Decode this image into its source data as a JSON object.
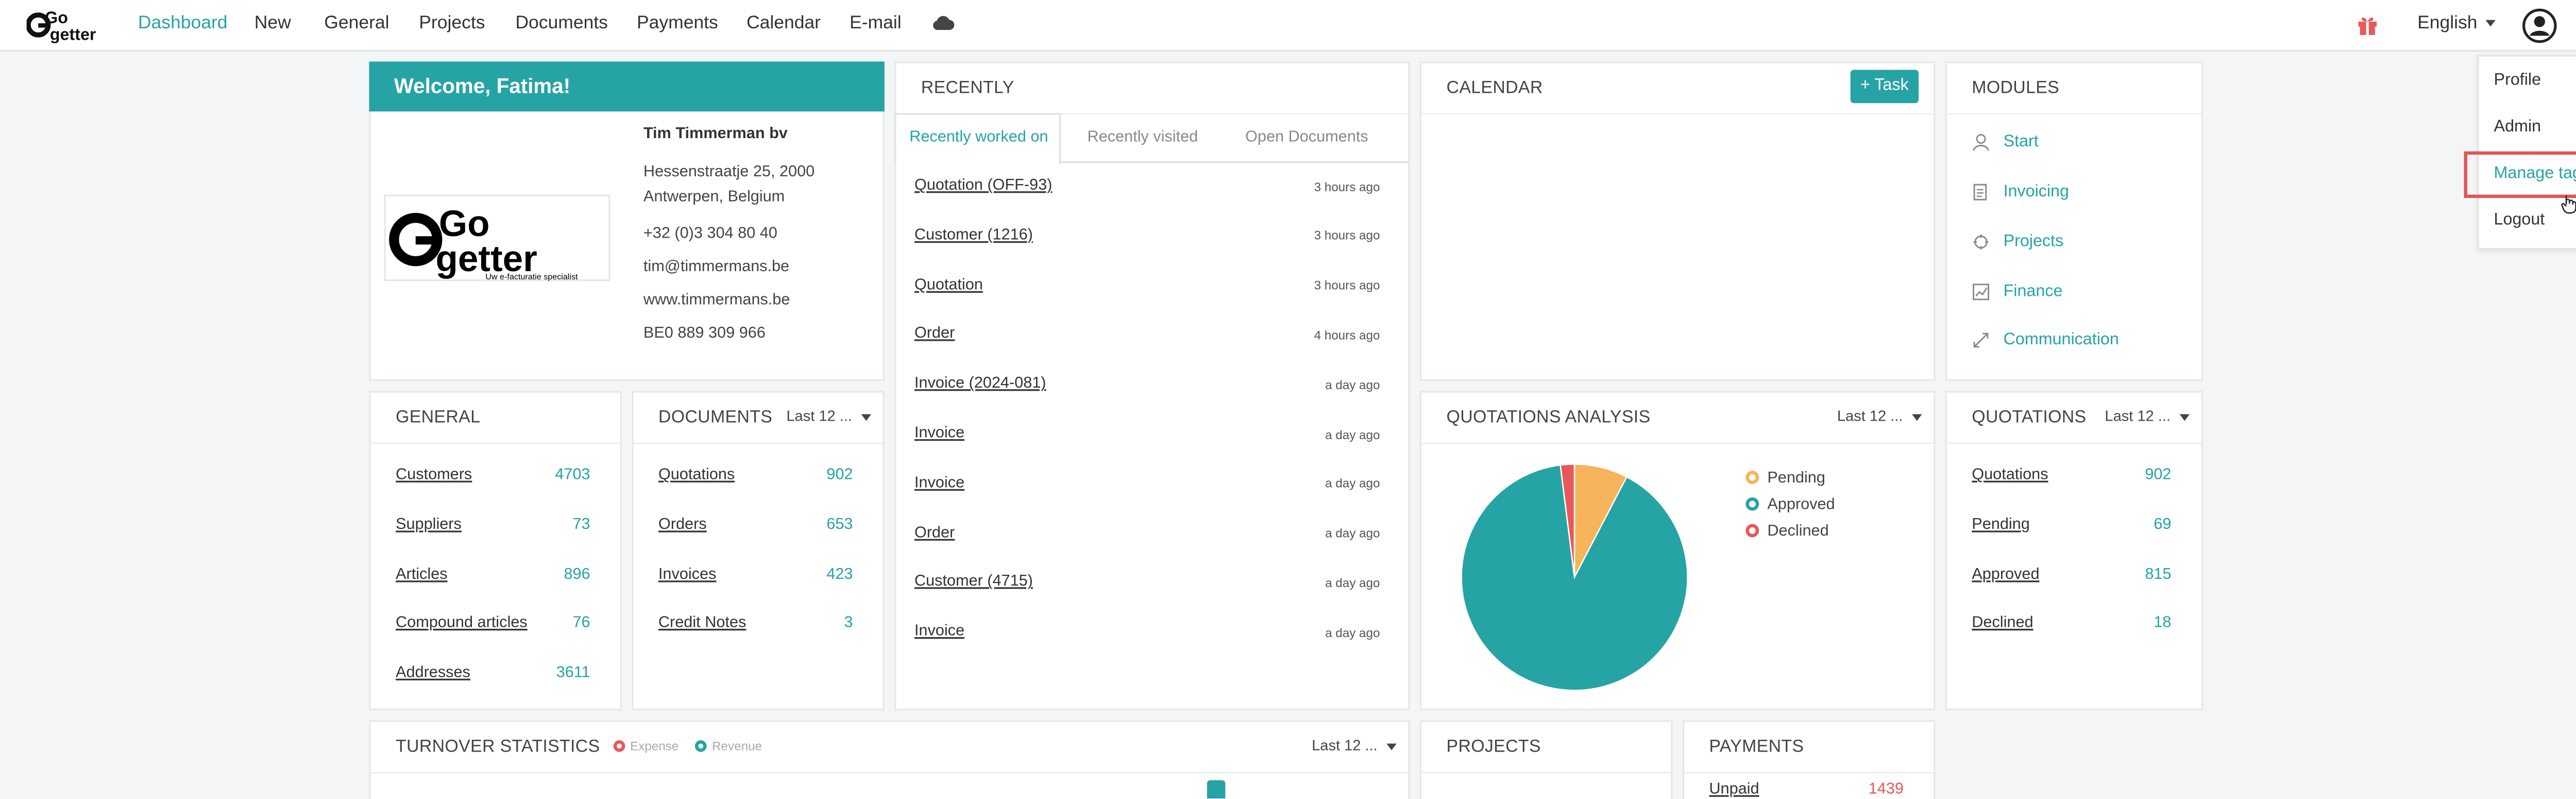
{
  "nav": {
    "items": [
      "Dashboard",
      "New",
      "General",
      "Projects",
      "Documents",
      "Payments",
      "Calendar",
      "E-mail"
    ],
    "language": "English"
  },
  "user_menu": {
    "items": [
      "Profile",
      "Admin",
      "Manage tags",
      "Logout"
    ],
    "highlighted": "Manage tags"
  },
  "welcome": {
    "title": "Welcome, Fatima!",
    "company": "Tim Timmerman bv",
    "address_line1": "Hessenstraatje 25, 2000",
    "address_line2": "Antwerpen, Belgium",
    "phone": "+32 (0)3 304 80 40",
    "email": "tim@timmermans.be",
    "website": "www.timmermans.be",
    "vat": "BE0 889 309 966",
    "logo_text": "Go getter",
    "logo_tagline": "Uw e-facturatie specialist"
  },
  "recently": {
    "title": "RECENTLY",
    "tabs": [
      "Recently worked on",
      "Recently visited",
      "Open Documents"
    ],
    "active_tab": "Recently worked on",
    "items": [
      {
        "label": "Quotation (OFF-93)",
        "time": "3 hours ago"
      },
      {
        "label": "Customer (1216)",
        "time": "3 hours ago"
      },
      {
        "label": "Quotation",
        "time": "3 hours ago"
      },
      {
        "label": "Order",
        "time": "4 hours ago"
      },
      {
        "label": "Invoice (2024-081)",
        "time": "a day ago"
      },
      {
        "label": "Invoice",
        "time": "a day ago"
      },
      {
        "label": "Invoice",
        "time": "a day ago"
      },
      {
        "label": "Order",
        "time": "a day ago"
      },
      {
        "label": "Customer (4715)",
        "time": "a day ago"
      },
      {
        "label": "Invoice",
        "time": "a day ago"
      }
    ]
  },
  "calendar": {
    "title": "CALENDAR",
    "task_button": "+ Task"
  },
  "modules": {
    "title": "MODULES",
    "items": [
      {
        "label": "Start",
        "icon": "person-icon"
      },
      {
        "label": "Invoicing",
        "icon": "invoice-icon"
      },
      {
        "label": "Projects",
        "icon": "projects-icon"
      },
      {
        "label": "Finance",
        "icon": "finance-icon"
      },
      {
        "label": "Communication",
        "icon": "communication-icon"
      }
    ]
  },
  "general": {
    "title": "GENERAL",
    "rows": [
      {
        "label": "Customers",
        "count": "4703"
      },
      {
        "label": "Suppliers",
        "count": "73"
      },
      {
        "label": "Articles",
        "count": "896"
      },
      {
        "label": "Compound articles",
        "count": "76"
      },
      {
        "label": "Addresses",
        "count": "3611"
      }
    ]
  },
  "documents": {
    "title": "DOCUMENTS",
    "filter": "Last 12 ...",
    "rows": [
      {
        "label": "Quotations",
        "count": "902"
      },
      {
        "label": "Orders",
        "count": "653"
      },
      {
        "label": "Invoices",
        "count": "423"
      },
      {
        "label": "Credit Notes",
        "count": "3"
      }
    ]
  },
  "quotations_analysis": {
    "title": "QUOTATIONS ANALYSIS",
    "filter": "Last 12 ..."
  },
  "quotations": {
    "title": "QUOTATIONS",
    "filter": "Last 12 ...",
    "rows": [
      {
        "label": "Quotations",
        "count": "902"
      },
      {
        "label": "Pending",
        "count": "69"
      },
      {
        "label": "Approved",
        "count": "815"
      },
      {
        "label": "Declined",
        "count": "18"
      }
    ]
  },
  "turnover": {
    "title": "TURNOVER STATISTICS",
    "legend": [
      "Expense",
      "Revenue"
    ],
    "filter": "Last 12 ..."
  },
  "projects": {
    "title": "PROJECTS"
  },
  "payments": {
    "title": "PAYMENTS",
    "rows": [
      {
        "label": "Unpaid",
        "count": "1439"
      }
    ]
  },
  "colors": {
    "accent": "#26a3a5",
    "pending": "#f7b45a",
    "approved": "#26a3a5",
    "declined": "#e8585a",
    "highlight_box": "#e25555"
  },
  "chart_data": {
    "type": "pie",
    "categories": [
      "Pending",
      "Approved",
      "Declined"
    ],
    "values": [
      69,
      815,
      18
    ],
    "legend_position": "right"
  }
}
